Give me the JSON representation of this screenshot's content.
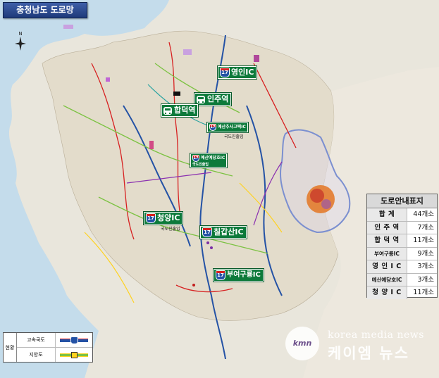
{
  "title": "충청남도 도로망",
  "compass_label": "N",
  "signs": {
    "yeongin_ic": {
      "label": "영인IC",
      "route": "17"
    },
    "inju_station": {
      "label": "인주역"
    },
    "hapdeok_station": {
      "label": "합덕역"
    },
    "yesan_suhyeon_ic": {
      "label": "예산추사고택IC",
      "route": "17"
    },
    "yesan_suhyeon_note": "국도진출입",
    "yesan_yedang_ic": {
      "label": "예산예당호IC",
      "route": "17",
      "sub": "국도진출입"
    },
    "cheongyang_ic": {
      "label": "청양IC",
      "route": "17"
    },
    "cheongyang_note": "국도진출입",
    "chilgapsan_ic": {
      "label": "칠갑산IC",
      "route": "17"
    },
    "buyeo_gu_ic": {
      "label": "부여구룡IC",
      "route": "17"
    }
  },
  "info_table": {
    "header": "도로안내표지",
    "rows": [
      {
        "label": "합 계",
        "count": "44개소"
      },
      {
        "label": "인 주 역",
        "count": "7개소"
      },
      {
        "label": "합 덕 역",
        "count": "11개소"
      },
      {
        "label": "부여구룡IC",
        "count": "9개소"
      },
      {
        "label": "영 인 I C",
        "count": "3개소"
      },
      {
        "label": "예산예당호IC",
        "count": "3개소"
      },
      {
        "label": "청 양 I C",
        "count": "11개소"
      }
    ]
  },
  "legend": {
    "title": "현황",
    "items": [
      {
        "label": "고속국도",
        "icon": "expressway-line-icon",
        "color": "#2452a5"
      },
      {
        "label": "지방도",
        "icon": "local-road-line-icon",
        "color": "#7cc242"
      }
    ]
  },
  "watermark": {
    "logo": "kmn",
    "en": "korea media news",
    "ko": "케이엠 뉴스"
  },
  "colors": {
    "land": "#e9e6dc",
    "sea": "#c4dceb",
    "expressway": "#2452a5",
    "national_road": "#d72121",
    "local_road": "#7cc242",
    "sign_green": "#0d7a3b",
    "region_outline": "#7b8fd0"
  }
}
